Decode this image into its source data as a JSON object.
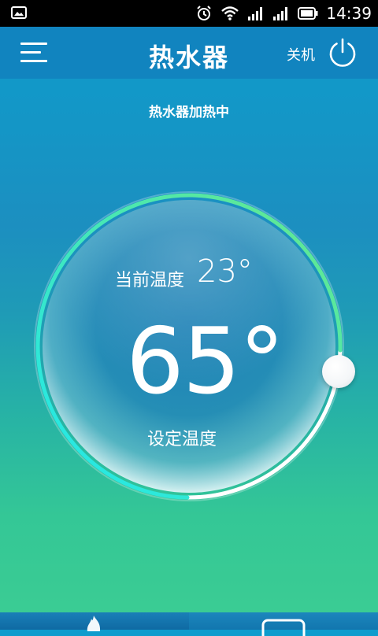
{
  "statusbar": {
    "time": "14:39",
    "icons": [
      "gallery-icon",
      "alarm-icon",
      "wifi-icon",
      "signal-icon",
      "signal-icon",
      "battery-icon"
    ]
  },
  "header": {
    "title": "热水器",
    "power_label": "关机",
    "menu_icon": "menu-icon",
    "power_icon": "power-icon"
  },
  "status": {
    "text": "热水器加热中"
  },
  "dial": {
    "current_label": "当前温度",
    "current_value": "23°",
    "set_value": "65°",
    "set_label": "设定温度",
    "colors": {
      "arc_start": "#20e5e8",
      "arc_end": "#5fe88a",
      "track": "#ffffff"
    }
  },
  "bottom_tabs": {
    "left_icon": "flame-icon",
    "right_icon": "screen-icon"
  }
}
